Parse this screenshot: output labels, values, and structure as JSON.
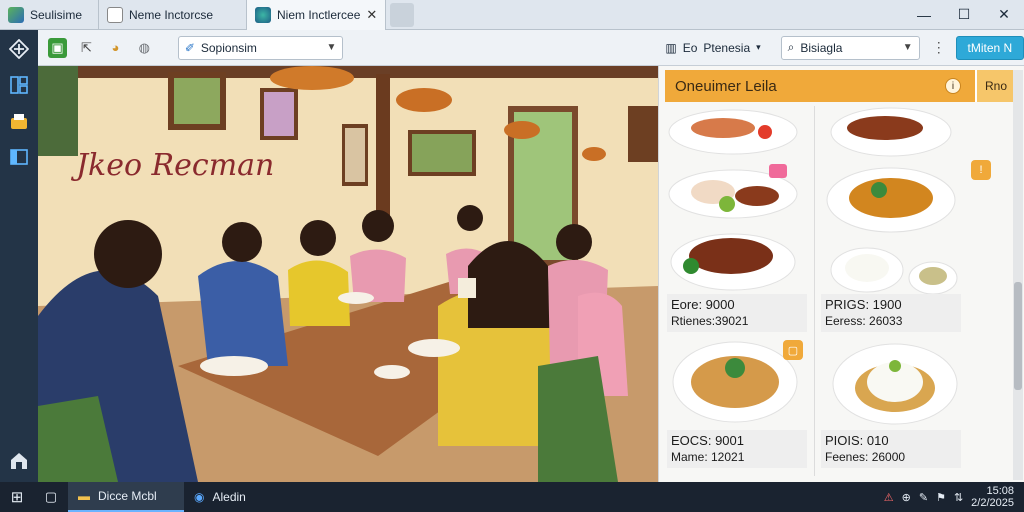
{
  "tabs": [
    {
      "label": "Seulisime"
    },
    {
      "label": "Neme  Inctorcse"
    },
    {
      "label": "Niem Inctlercee",
      "close": "✕"
    }
  ],
  "window_controls": {
    "minimize": "—",
    "maximize": "☐",
    "close": "✕"
  },
  "appbar": {
    "icons": [
      "diamond-nav-icon",
      "grid-icon",
      "bag-icon",
      "panel-icon"
    ],
    "bottom_icon": "home-icon"
  },
  "toolbar": {
    "main_select": "Sopionsim",
    "language": "Ptenesia",
    "language_prefix": "Eo",
    "search": "Bisiagla",
    "menu": "⋮",
    "primary_button": "tMiten N"
  },
  "scene": {
    "wall_sign": "Jkeo Recman"
  },
  "panel": {
    "title": "Oneuimer Leila",
    "info_icon": "i",
    "tag": "Rno",
    "items": [
      {
        "line1": "Eore: 9000",
        "line2": "Rtienes:39021"
      },
      {
        "line1": "PRIGS: 1900",
        "line2": "Eeress: 26033"
      },
      {
        "line1": "EOCS: 9001",
        "line2": "Mame: 12021"
      },
      {
        "line1": "PIOIS: 010",
        "line2": "Feenes: 26000"
      }
    ]
  },
  "taskbar": {
    "items": [
      {
        "label": "Dicce Mcbl"
      },
      {
        "label": "Aledin"
      }
    ],
    "tray": [
      "⚠",
      "⊕",
      "✎",
      "⚑",
      "⇅"
    ],
    "clock": [
      "15:08",
      "2/2/2025"
    ]
  },
  "colors": {
    "accent": "#f0a93a",
    "primary": "#2ea9d8",
    "sidebar": "#233447"
  }
}
